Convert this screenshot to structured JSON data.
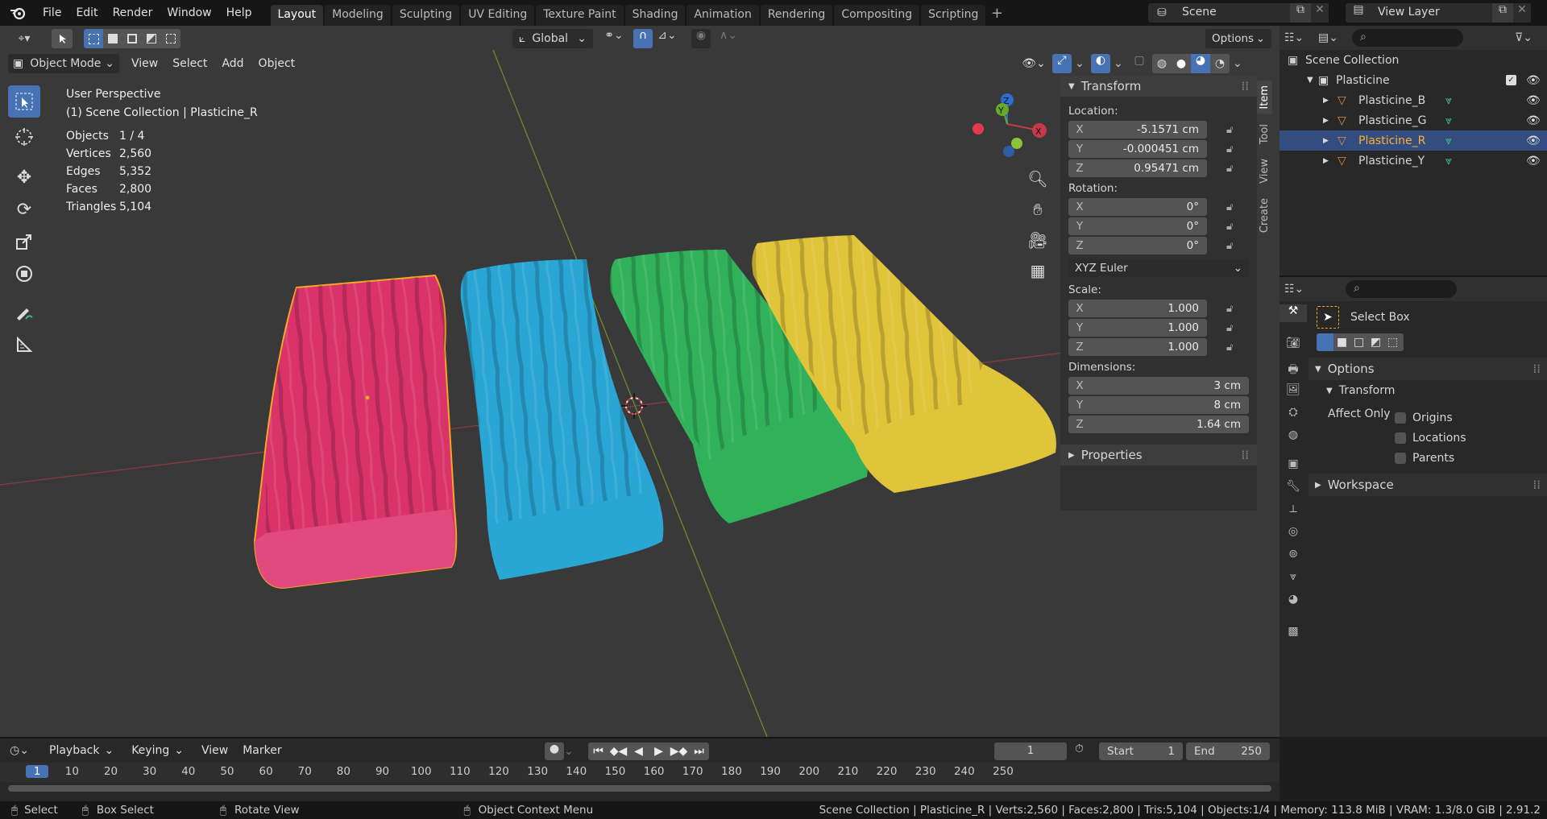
{
  "menus": [
    "File",
    "Edit",
    "Render",
    "Window",
    "Help"
  ],
  "workspaces": [
    "Layout",
    "Modeling",
    "Sculpting",
    "UV Editing",
    "Texture Paint",
    "Shading",
    "Animation",
    "Rendering",
    "Compositing",
    "Scripting"
  ],
  "active_workspace": "Layout",
  "scene_name": "Scene",
  "view_layer": "View Layer",
  "header": {
    "orientation": "Global",
    "options": "Options",
    "mode": "Object Mode",
    "menus": [
      "View",
      "Select",
      "Add",
      "Object"
    ]
  },
  "overlay": {
    "perspective": "User Perspective",
    "collection": "(1) Scene Collection | Plasticine_R",
    "stats": [
      {
        "label": "Objects",
        "value": "1 / 4"
      },
      {
        "label": "Vertices",
        "value": "2,560"
      },
      {
        "label": "Edges",
        "value": "5,352"
      },
      {
        "label": "Faces",
        "value": "2,800"
      },
      {
        "label": "Triangles",
        "value": "5,104"
      }
    ]
  },
  "gizmo": {
    "x": "X",
    "y": "Y",
    "z": "Z"
  },
  "npanel": {
    "tabs": [
      "Item",
      "Tool",
      "View",
      "Create"
    ],
    "transform_title": "Transform",
    "location_label": "Location:",
    "location": [
      {
        "axis": "X",
        "value": "-5.1571 cm"
      },
      {
        "axis": "Y",
        "value": "-0.000451 cm"
      },
      {
        "axis": "Z",
        "value": "0.95471 cm"
      }
    ],
    "rotation_label": "Rotation:",
    "rotation": [
      {
        "axis": "X",
        "value": "0°"
      },
      {
        "axis": "Y",
        "value": "0°"
      },
      {
        "axis": "Z",
        "value": "0°"
      }
    ],
    "rotation_mode": "XYZ Euler",
    "scale_label": "Scale:",
    "scale": [
      {
        "axis": "X",
        "value": "1.000"
      },
      {
        "axis": "Y",
        "value": "1.000"
      },
      {
        "axis": "Z",
        "value": "1.000"
      }
    ],
    "dimensions_label": "Dimensions:",
    "dimensions": [
      {
        "axis": "X",
        "value": "3 cm"
      },
      {
        "axis": "Y",
        "value": "8 cm"
      },
      {
        "axis": "Z",
        "value": "1.64 cm"
      }
    ],
    "properties_title": "Properties"
  },
  "outliner": {
    "root": "Scene Collection",
    "collection": "Plasticine",
    "objects": [
      {
        "name": "Plasticine_B",
        "selected": false
      },
      {
        "name": "Plasticine_G",
        "selected": false
      },
      {
        "name": "Plasticine_R",
        "selected": true
      },
      {
        "name": "Plasticine_Y",
        "selected": false
      }
    ]
  },
  "properties": {
    "tool_name": "Select Box",
    "options_title": "Options",
    "transform_title": "Transform",
    "affect_only": "Affect Only",
    "checks": [
      "Origins",
      "Locations",
      "Parents"
    ],
    "workspace_title": "Workspace"
  },
  "timeline": {
    "menus": [
      "Playback",
      "Keying",
      "View",
      "Marker"
    ],
    "current_frame": "1",
    "start_label": "Start",
    "start": "1",
    "end_label": "End",
    "end": "250",
    "ruler": [
      "1",
      "10",
      "20",
      "30",
      "40",
      "50",
      "60",
      "70",
      "80",
      "90",
      "100",
      "110",
      "120",
      "130",
      "140",
      "150",
      "160",
      "170",
      "180",
      "190",
      "200",
      "210",
      "220",
      "230",
      "240",
      "250"
    ]
  },
  "statusbar": {
    "left": [
      "Select",
      "Box Select",
      "Rotate View",
      "Object Context Menu"
    ],
    "right": "Scene Collection | Plasticine_R | Verts:2,560 | Faces:2,800 | Tris:5,104 | Objects:1/4 | Memory: 113.8 MiB | VRAM: 1.3/8.0 GiB | 2.91.2"
  },
  "colors": {
    "accent": "#4772b3",
    "selected_outline": "#f5a623",
    "pink": "#d9336a",
    "blue": "#2aa6d4",
    "green": "#31b25a",
    "yellow": "#e0c43a"
  }
}
